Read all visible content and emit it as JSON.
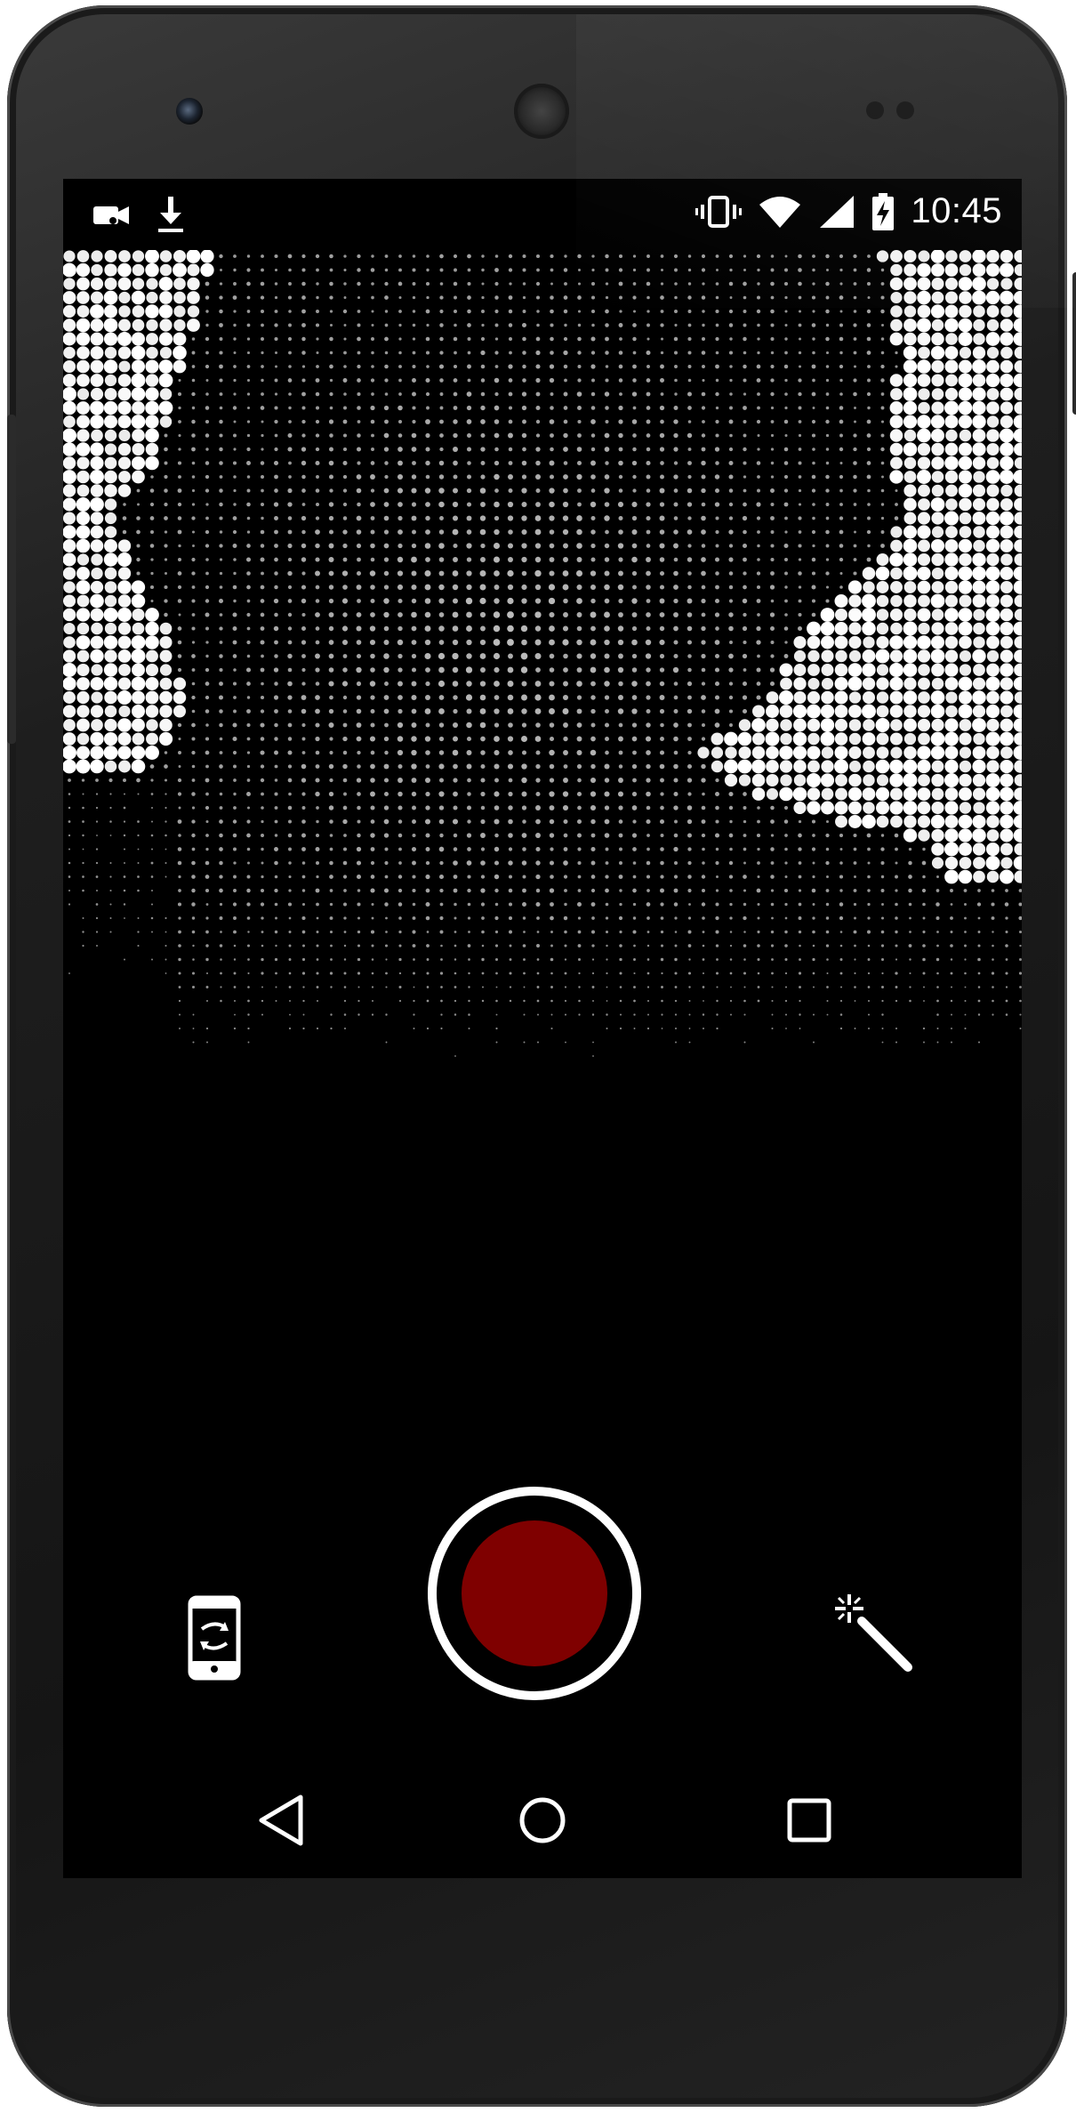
{
  "status_bar": {
    "time": "10:45",
    "left_icons": [
      "video-record-notification-icon",
      "download-icon"
    ],
    "right_icons": [
      "vibrate-icon",
      "wifi-icon",
      "cell-signal-icon",
      "battery-charging-icon"
    ]
  },
  "camera_preview": {
    "effect": "halftone-dots",
    "icon": "halftone-camera-feed"
  },
  "controls": {
    "switch_camera_icon": "rotate-phone-icon",
    "record_icon": "record-icon",
    "effects_icon": "magic-wand-icon"
  },
  "nav_bar": {
    "icons": [
      "back-icon",
      "home-icon",
      "recents-icon"
    ]
  },
  "colors": {
    "record_fill": "#7f0000",
    "screen_bg": "#000000",
    "icon": "#ffffff",
    "phone_body": "#1e1e1e"
  }
}
